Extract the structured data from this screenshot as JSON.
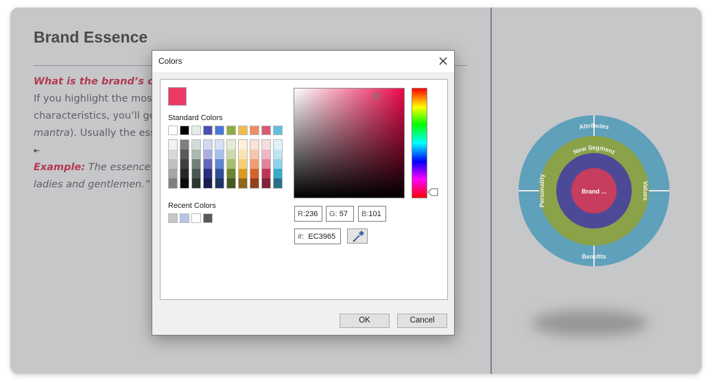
{
  "slide": {
    "title": "Brand Essence",
    "question": "What is the brand’s core",
    "line1": "If you highlight the most",
    "line2": "characteristics, you’ll get",
    "line3_italic": "mantra",
    "line3_rest": "). Usually the esse",
    "example_label": "Example:",
    "example_text": " The essence of t",
    "line6": "ladies and gentlemen.”"
  },
  "diagram": {
    "outer_top": "Attributes",
    "outer_bottom": "Benefits",
    "mid_left": "Personality",
    "mid_right": "Values",
    "inner_label": "New Segment",
    "center_label": "Brand ...",
    "colors": {
      "outer": "#5fa0bb",
      "middle": "#8aa348",
      "inner": "#4c4a97",
      "center": "#c63d5d"
    }
  },
  "dialog": {
    "title": "Colors",
    "current_color": "#EC3965",
    "standard_label": "Standard Colors",
    "recent_label": "Recent Colors",
    "standard_colors": [
      "#ffffff",
      "#000000",
      "#e4ece8",
      "#4b4fb0",
      "#4a78d8",
      "#8fac40",
      "#f2bc4a",
      "#ee8d5e",
      "#d85b73",
      "#62bfdc"
    ],
    "shade_columns": [
      [
        "#f2f2f2",
        "#d8d8d8",
        "#bfbfbf",
        "#a5a5a5",
        "#7f7f7f"
      ],
      [
        "#7f7f7f",
        "#595959",
        "#3f3f3f",
        "#262626",
        "#0c0c0c"
      ],
      [
        "#d3dcd8",
        "#a9b8b1",
        "#6f8178",
        "#4a5851",
        "#2b3530"
      ],
      [
        "#d5d6ef",
        "#abacdf",
        "#6466bd",
        "#2c2e7e",
        "#1a1c52"
      ],
      [
        "#d4dff6",
        "#a9c0ec",
        "#5d86d4",
        "#2f5098",
        "#1f3566"
      ],
      [
        "#e5ecd5",
        "#cbd9ac",
        "#a8bf6a",
        "#6c8330",
        "#485720"
      ],
      [
        "#fcf1d7",
        "#f9e3b0",
        "#f4cf72",
        "#d99a22",
        "#916716"
      ],
      [
        "#fbe2d6",
        "#f7c5ad",
        "#f19b74",
        "#d8622d",
        "#90411e"
      ],
      [
        "#f6dbe1",
        "#eeb7c3",
        "#e18498",
        "#bd3654",
        "#7e2438"
      ],
      [
        "#dff2f8",
        "#bfe5f1",
        "#8dd2e8",
        "#3aa9cc",
        "#277188"
      ]
    ],
    "recent_colors": [
      "#c6c7c9",
      "#b4c7e7",
      "#ffffff",
      "#595959"
    ],
    "r_label": "R:",
    "r_value": "236",
    "g_label": "G:",
    "g_value": "57",
    "b_label": "B:",
    "b_value": "101",
    "hex_label": "#:",
    "hex_value": "EC3965",
    "ok_label": "OK",
    "cancel_label": "Cancel"
  }
}
